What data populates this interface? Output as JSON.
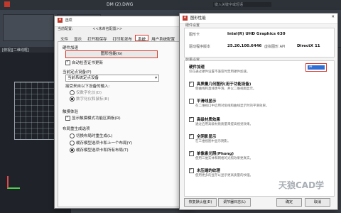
{
  "cad": {
    "title": "DM (2).DWG",
    "search_placeholder": "键入关键字或短语",
    "drawing_tab": "[俯视][二维线框]"
  },
  "options_dialog": {
    "title": "选项",
    "current_config_label": "当前配置:",
    "current_config_value": "<<未命名配置>>",
    "tabs": [
      "文件",
      "显示",
      "打开和保存",
      "打印和发布",
      "系统",
      "用户系统配置"
    ],
    "active_tab": "系统",
    "hw_group": "硬件加速",
    "graphics_perf_button": "图形性能(G)",
    "auto_check_updates": "自动检查证书更新",
    "pointing_device_group": "当前定点设备(P)",
    "pointing_device_value": "当前系统定点设备",
    "accept_input_from": "接受来自以下设备的输入:",
    "radio_digitizer_only": "仅数字化仪(D)",
    "radio_digitizer_mouse": "数字化仪和鼠标(B)",
    "touch_group": "触摸体验",
    "touch_option": "显示触摸模式功能区面板(R)",
    "layout_regen_group": "布局重生成选项",
    "regen_option_1": "切换布局时重生成(L)",
    "regen_option_2": "缓存模型选项卡和上一个布局(Y)",
    "regen_option_3": "缓存模型选项卡和所有布局(T)"
  },
  "graphics_dialog": {
    "title": "图形性能",
    "hw_settings_label": "硬件设置",
    "gpu_label": "图形卡",
    "gpu_value": "Intel(R) UHD Graphics 630",
    "driver_version_label": "驱动程序版本",
    "driver_version_value": "25.20.100.6446",
    "api_label": "虚拟图形 API",
    "api_value": "DirectX 11",
    "effects_label": "效果设置",
    "hw_accel_label": "硬件加速",
    "hw_accel_desc": "仅在通过硬件设置不兼容时禁用硬件加速。",
    "toggle_label": "开",
    "effects": [
      {
        "name": "高质量几何图形(用于功能设备)",
        "desc": "使曲线和直线更平滑，并以二维视图显示。",
        "checked": true
      },
      {
        "name": "平滑线显示",
        "desc": "在二维视口中启用对角线和曲线显示时的平滑效果。",
        "checked": false
      },
      {
        "name": "高级材质效果",
        "desc": "通过启用高级材质质量来提高视觉效果。",
        "checked": true
      },
      {
        "name": "全阴影显示",
        "desc": "在三维视图中显示阴影。",
        "checked": true
      },
      {
        "name": "单像素光照(Phong)",
        "desc": "使用三维实体和网格的光照效果更真实。",
        "checked": true
      },
      {
        "name": "未压缩的纹理",
        "desc": "使用更多的显存以显示更高质量的纹理。",
        "checked": true
      }
    ],
    "btn_default": "恢复默认值(D)",
    "btn_tune": "调节器日志(L)",
    "btn_ok": "确定",
    "btn_cancel": "取消"
  },
  "watermark": "天狼CAD学",
  "colors": {
    "accent_red": "#d9392b",
    "toggle_blue": "#2f6fd6"
  }
}
